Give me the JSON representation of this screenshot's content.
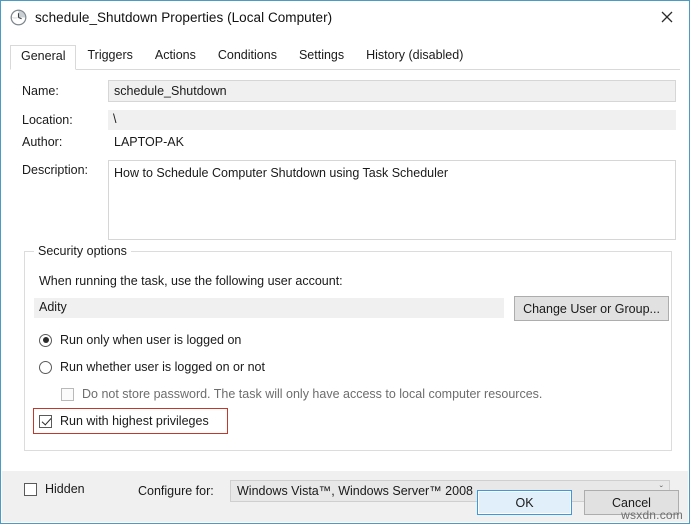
{
  "window": {
    "title": "schedule_Shutdown Properties (Local Computer)",
    "icon": "clock-scheduler-icon",
    "close_label": "close-icon",
    "border_color": "#4a9cc4"
  },
  "tabs": [
    {
      "label": "General",
      "active": true
    },
    {
      "label": "Triggers",
      "active": false
    },
    {
      "label": "Actions",
      "active": false
    },
    {
      "label": "Conditions",
      "active": false
    },
    {
      "label": "Settings",
      "active": false
    },
    {
      "label": "History (disabled)",
      "active": false
    }
  ],
  "general": {
    "name_label": "Name:",
    "name_value": "schedule_Shutdown",
    "location_label": "Location:",
    "location_value": "\\",
    "author_label": "Author:",
    "author_value": "LAPTOP-AK",
    "description_label": "Description:",
    "description_value": "How to Schedule Computer Shutdown using Task Scheduler"
  },
  "security": {
    "group_label": "Security options",
    "account_prompt": "When running the task, use the following user account:",
    "account_value": "Adity",
    "change_user_button": "Change User or Group...",
    "radio_logged_on": "Run only when user is logged on",
    "radio_whether_logged": "Run whether user is logged on or not",
    "radio_selected": "Run only when user is logged on",
    "checkbox_no_password": "Do not store password.  The task will only have access to local computer resources.",
    "checkbox_no_password_checked": false,
    "checkbox_no_password_disabled": true,
    "checkbox_highest_privileges": "Run with highest privileges",
    "checkbox_highest_privileges_checked": true,
    "highlight_color": "#c0392b"
  },
  "footer": {
    "hidden_label": "Hidden",
    "hidden_checked": false,
    "configure_for_label": "Configure for:",
    "configure_for_value": "Windows Vista™, Windows Server™ 2008",
    "chevron": "ˇ",
    "ok_button": "OK",
    "cancel_button": "Cancel"
  },
  "watermark": "wsxdn.com"
}
